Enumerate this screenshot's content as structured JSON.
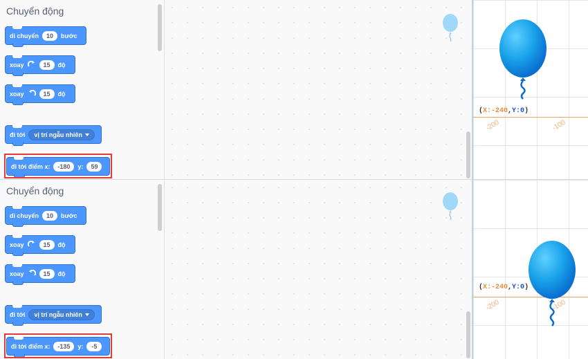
{
  "panels": [
    {
      "palette_title": "Chuyển động",
      "blocks": {
        "move": {
          "label": "di chuyển",
          "value": "10",
          "unit": "bước"
        },
        "turn_right": {
          "label": "xoay",
          "value": "15",
          "unit": "độ"
        },
        "turn_left": {
          "label": "xoay",
          "value": "15",
          "unit": "độ"
        },
        "goto": {
          "label": "đi tới",
          "option": "vị trí ngẫu nhiên"
        },
        "goto_xy": {
          "label": "đi tới điểm x:",
          "x": "-180",
          "y_label": "y:",
          "y": "59"
        }
      },
      "stage": {
        "coord_x": "X:-240",
        "coord_y": "Y:0",
        "tick_left": "-200",
        "tick_right": "-100"
      }
    },
    {
      "palette_title": "Chuyển động",
      "blocks": {
        "move": {
          "label": "di chuyển",
          "value": "10",
          "unit": "bước"
        },
        "turn_right": {
          "label": "xoay",
          "value": "15",
          "unit": "độ"
        },
        "turn_left": {
          "label": "xoay",
          "value": "15",
          "unit": "độ"
        },
        "goto": {
          "label": "đi tới",
          "option": "vị trí ngẫu nhiên"
        },
        "goto_xy": {
          "label": "đi tới điểm x:",
          "x": "-135",
          "y_label": "y:",
          "y": "-5"
        }
      },
      "stage": {
        "coord_x": "X:-240",
        "coord_y": "Y:0",
        "tick_left": "-200",
        "tick_right": "-100"
      }
    }
  ],
  "colors": {
    "motion_block": "#4c97ff",
    "highlight": "#e23a3a",
    "balloon": "#1e90ff"
  },
  "icons": {
    "turn_right": "rotate-clockwise-icon",
    "turn_left": "rotate-counterclockwise-icon",
    "sprite": "balloon-icon"
  }
}
